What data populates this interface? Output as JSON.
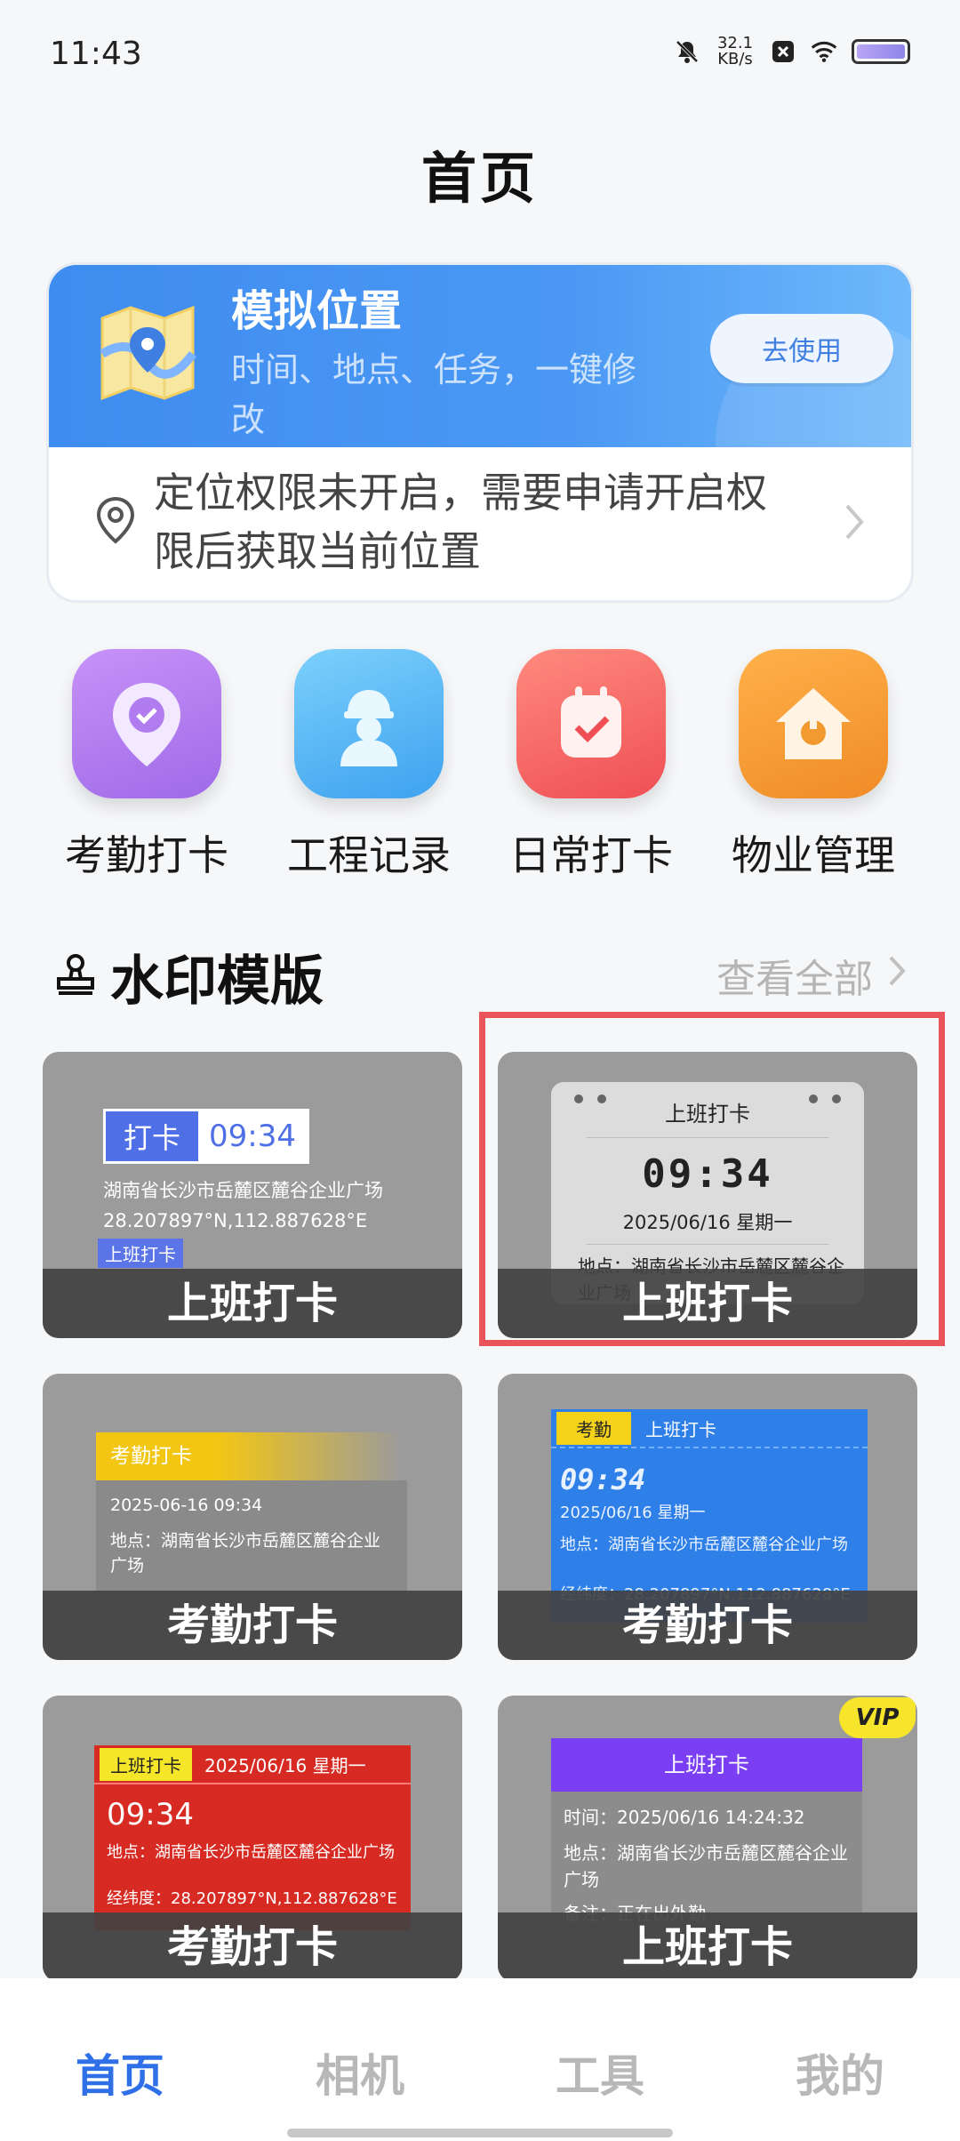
{
  "status_bar": {
    "time": "11:43",
    "speed_value": "32.1",
    "speed_unit": "KB/s",
    "icons": [
      "mute-icon",
      "close-badge-icon",
      "wifi-icon",
      "battery-icon"
    ]
  },
  "page_title": "首页",
  "hero": {
    "title": "模拟位置",
    "subtitle": "时间、地点、任务，一键修改",
    "button": "去使用",
    "permission_text": "定位权限未开启，需要申请开启权限后获取当前位置",
    "accent": "#3f8cf0"
  },
  "quick_actions": [
    {
      "label": "考勤打卡",
      "icon": "location-check-icon",
      "color": "#b47cf2"
    },
    {
      "label": "工程记录",
      "icon": "worker-icon",
      "color": "#54b4f4"
    },
    {
      "label": "日常打卡",
      "icon": "calendar-check-icon",
      "color": "#f2605e"
    },
    {
      "label": "物业管理",
      "icon": "house-wrench-icon",
      "color": "#f59a2f"
    }
  ],
  "watermark": {
    "section_title": "水印模版",
    "view_all": "查看全部",
    "cards": [
      {
        "caption": "上班打卡",
        "tag_key": "打卡",
        "tag_time": "09:34",
        "address": "湖南省长沙市岳麓区麓谷企业广场",
        "coords": "28.207897°N,112.887628°E",
        "badge": "上班打卡"
      },
      {
        "caption": "上班打卡",
        "selected": true,
        "title": "上班打卡",
        "time": "09:34",
        "date": "2025/06/16   星期一",
        "location": "地点：湖南省长沙市岳麓区麓谷企业广场"
      },
      {
        "caption": "考勤打卡",
        "head": "考勤打卡",
        "datetime": "2025-06-16    09:34",
        "location": "地点：湖南省长沙市岳麓区麓谷企业广场"
      },
      {
        "caption": "考勤打卡",
        "tag_key": "考勤",
        "tag_value": "上班打卡",
        "time": "09:34",
        "date": "2025/06/16   星期一",
        "location": "地点：湖南省长沙市岳麓区麓谷企业广场",
        "coords": "经纬度：28.207897°N,112.887628°E"
      },
      {
        "caption": "考勤打卡",
        "tag_key": "上班打卡",
        "tag_value": "2025/06/16   星期一",
        "time": "09:34",
        "location": "地点：湖南省长沙市岳麓区麓谷企业广场",
        "coords": "经纬度：28.207897°N,112.887628°E"
      },
      {
        "caption": "上班打卡",
        "vip": "VIP",
        "head": "上班打卡",
        "time_line": "时间：2025/06/16    14:24:32",
        "location": "地点：湖南省长沙市岳麓区麓谷企业广场",
        "note": "备注：正在出外勤"
      }
    ]
  },
  "bottom_nav": {
    "items": [
      "首页",
      "相机",
      "工具",
      "我的"
    ],
    "active": "首页"
  }
}
